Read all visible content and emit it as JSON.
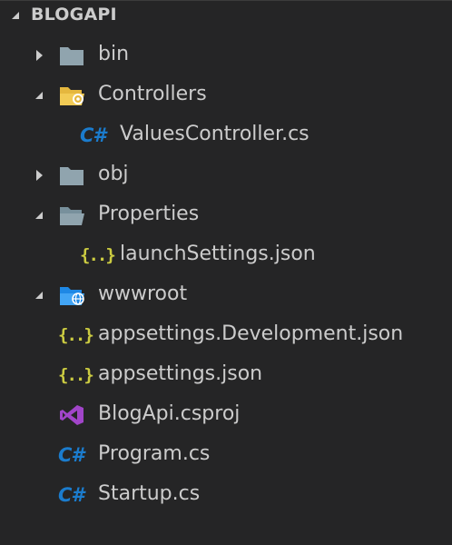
{
  "explorer": {
    "section_title": "BLOGAPI",
    "items": [
      {
        "label": "bin",
        "kind": "folder",
        "state": "collapsed",
        "icon": "folder-icon"
      },
      {
        "label": "Controllers",
        "kind": "folder",
        "state": "expanded",
        "icon": "folder-controllers-icon"
      },
      {
        "label": "ValuesController.cs",
        "kind": "file",
        "icon": "csharp-icon",
        "icon_text": "C#"
      },
      {
        "label": "obj",
        "kind": "folder",
        "state": "collapsed",
        "icon": "folder-icon"
      },
      {
        "label": "Properties",
        "kind": "folder",
        "state": "expanded",
        "icon": "folder-open-icon"
      },
      {
        "label": "launchSettings.json",
        "kind": "file",
        "icon": "json-icon",
        "icon_text": "{..}"
      },
      {
        "label": "wwwroot",
        "kind": "folder",
        "state": "expanded",
        "icon": "folder-www-icon"
      },
      {
        "label": "appsettings.Development.json",
        "kind": "file",
        "icon": "json-icon",
        "icon_text": "{..}"
      },
      {
        "label": "appsettings.json",
        "kind": "file",
        "icon": "json-icon",
        "icon_text": "{..}"
      },
      {
        "label": "BlogApi.csproj",
        "kind": "file",
        "icon": "visual-studio-icon"
      },
      {
        "label": "Program.cs",
        "kind": "file",
        "icon": "csharp-icon",
        "icon_text": "C#"
      },
      {
        "label": "Startup.cs",
        "kind": "file",
        "icon": "csharp-icon",
        "icon_text": "C#"
      }
    ]
  },
  "colors": {
    "background": "#252526",
    "text": "#cccccc",
    "folder": "#90a4ae",
    "folder_controllers": "#e5b73e",
    "folder_www": "#1e88e5",
    "csharp": "#1b7ccd",
    "json": "#cbcb41",
    "csproj": "#a145c9"
  }
}
